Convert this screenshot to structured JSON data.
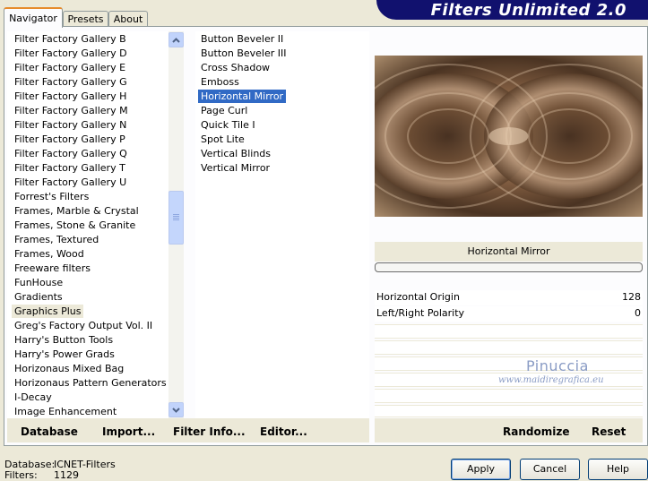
{
  "app": {
    "title": "Filters Unlimited 2.0"
  },
  "tabs": [
    {
      "label": "Navigator",
      "active": true
    },
    {
      "label": "Presets",
      "active": false
    },
    {
      "label": "About",
      "active": false
    }
  ],
  "categories": [
    "Filter Factory Gallery B",
    "Filter Factory Gallery D",
    "Filter Factory Gallery E",
    "Filter Factory Gallery G",
    "Filter Factory Gallery H",
    "Filter Factory Gallery M",
    "Filter Factory Gallery N",
    "Filter Factory Gallery P",
    "Filter Factory Gallery Q",
    "Filter Factory Gallery T",
    "Filter Factory Gallery U",
    "Forrest's Filters",
    "Frames, Marble & Crystal",
    "Frames, Stone & Granite",
    "Frames, Textured",
    "Frames, Wood",
    "Freeware filters",
    "FunHouse",
    "Gradients",
    "Graphics Plus",
    "Greg's Factory Output Vol. II",
    "Harry's Button Tools",
    "Harry's Power Grads",
    "Horizonaus Mixed Bag",
    "Horizonaus Pattern Generators",
    "I-Decay",
    "Image Enhancement"
  ],
  "selected_category": "Graphics Plus",
  "filters": [
    "Button Beveler II",
    "Button Beveler III",
    "Cross Shadow",
    "Emboss",
    "Horizontal Mirror",
    "Page Curl",
    "Quick Tile I",
    "Spot Lite",
    "Vertical Blinds",
    "Vertical Mirror"
  ],
  "selected_filter": "Horizontal Mirror",
  "list_toolbar": {
    "database": "Database",
    "import": "Import...",
    "filter_info": "Filter Info...",
    "editor": "Editor..."
  },
  "preview": {
    "filter_name": "Horizontal Mirror",
    "progress": 0
  },
  "params": [
    {
      "label": "Horizontal Origin",
      "value": "128"
    },
    {
      "label": "Left/Right Polarity",
      "value": "0"
    }
  ],
  "watermark": {
    "name": "Pinuccia",
    "site": "www.maidiregrafica.eu"
  },
  "param_toolbar": {
    "randomize": "Randomize",
    "reset": "Reset"
  },
  "status": {
    "database_label": "Database:",
    "database_value": "ICNET-Filters",
    "filters_label": "Filters:",
    "filters_value": "1129"
  },
  "buttons": {
    "apply": "Apply",
    "cancel": "Cancel",
    "help": "Help"
  },
  "icons": {
    "scroll_up": "chevron-up-icon",
    "scroll_down": "chevron-down-icon"
  },
  "colors": {
    "banner": "#11116e",
    "selection": "#316ac5",
    "tab_accent": "#e68b2c"
  }
}
